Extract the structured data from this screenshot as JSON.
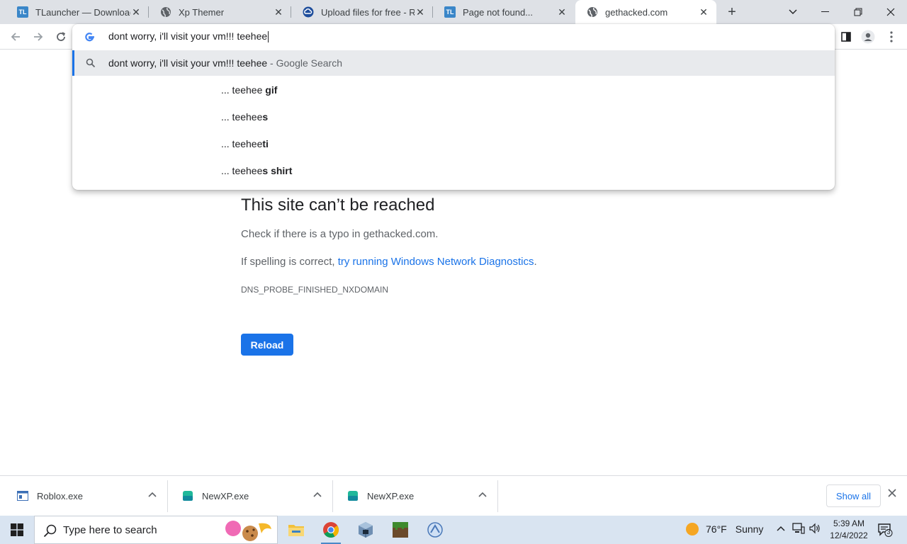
{
  "tabs": [
    {
      "title": "TLauncher — Download M",
      "favicon": "tlauncher-icon"
    },
    {
      "title": "Xp Themer",
      "favicon": "globe-icon"
    },
    {
      "title": "Upload files for free - Rob",
      "favicon": "cloud-icon"
    },
    {
      "title": "Page not found...",
      "favicon": "tlauncher-icon"
    },
    {
      "title": "gethacked.com",
      "favicon": "globe-icon",
      "active": true
    }
  ],
  "favicon_tl_text": "TL",
  "omnibox": {
    "text": "dont worry, i'll visit your vm!!! teehee",
    "top_suggestion": "dont worry, i'll visit your vm!!! teehee",
    "top_suffix": " - Google Search",
    "suggestions": [
      {
        "prefix": "... teehee ",
        "bold": "gif"
      },
      {
        "prefix": "... teehee",
        "bold": "s"
      },
      {
        "prefix": "... teehee",
        "bold": "ti"
      },
      {
        "prefix": "... teehee",
        "bold": "s shirt"
      }
    ]
  },
  "error": {
    "heading": "This site can’t be reached",
    "line1": "Check if there is a typo in gethacked.com.",
    "line2_prefix": "If spelling is correct, ",
    "line2_link": "try running Windows Network Diagnostics",
    "line2_suffix": ".",
    "code": "DNS_PROBE_FINISHED_NXDOMAIN",
    "reload_label": "Reload"
  },
  "downloads": {
    "items": [
      {
        "name": "Roblox.exe"
      },
      {
        "name": "NewXP.exe"
      },
      {
        "name": "NewXP.exe"
      }
    ],
    "show_all_label": "Show all"
  },
  "taskbar": {
    "search_placeholder": "Type here to search",
    "weather_temp": "76°F",
    "weather_text": "Sunny",
    "time": "5:39 AM",
    "date": "12/4/2022",
    "notification_count": "3"
  },
  "colors": {
    "accent": "#1a73e8",
    "tab_strip": "#dee1e6",
    "taskbar": "#d9e4f1"
  }
}
